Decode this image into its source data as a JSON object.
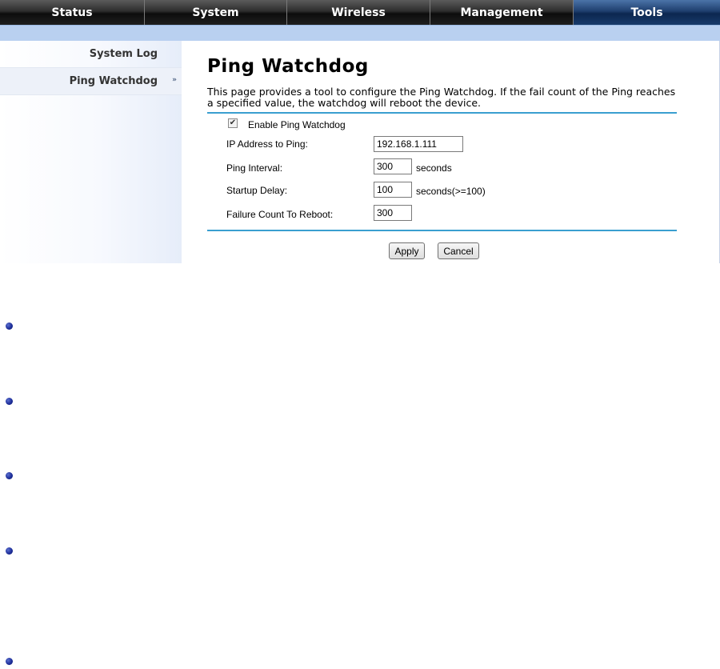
{
  "nav": {
    "tabs": [
      {
        "label": "Status"
      },
      {
        "label": "System"
      },
      {
        "label": "Wireless"
      },
      {
        "label": "Management"
      },
      {
        "label": "Tools"
      }
    ],
    "active": "Tools"
  },
  "sidebar": {
    "items": [
      {
        "label": "System Log"
      },
      {
        "label": "Ping Watchdog"
      }
    ],
    "active_arrow": "»"
  },
  "main": {
    "title": "Ping Watchdog",
    "description": "This page provides a tool to configure the Ping Watchdog. If the fail count of the Ping reaches a specified value, the watchdog will reboot the device.",
    "enable": {
      "label": "Enable Ping Watchdog",
      "checked": true,
      "mark": "✔"
    },
    "fields": {
      "ip": {
        "label": "IP Address to Ping:",
        "value": "192.168.1.111"
      },
      "interval": {
        "label": "Ping Interval:",
        "value": "300",
        "unit": "seconds"
      },
      "startup": {
        "label": "Startup Delay:",
        "value": "100",
        "unit": "seconds(>=100)"
      },
      "failure": {
        "label": "Failure Count To Reboot:",
        "value": "300"
      }
    },
    "buttons": {
      "apply": "Apply",
      "cancel": "Cancel"
    }
  },
  "colors": {
    "accent_line": "#3a9fd0",
    "subbar": "#b9d0f0",
    "active_tab": "#1e3e6e",
    "bullet": "#1e2f9a"
  }
}
